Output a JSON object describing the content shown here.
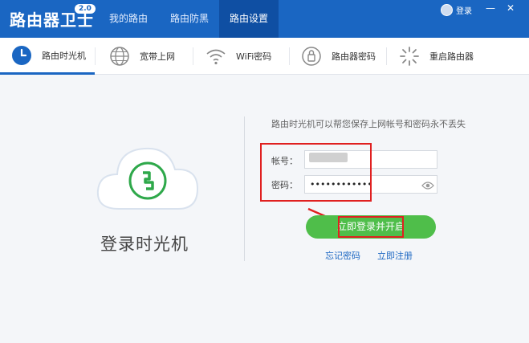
{
  "app": {
    "title": "路由器卫士",
    "version": "2.0"
  },
  "topnav": {
    "tabs": [
      {
        "label": "我的路由"
      },
      {
        "label": "路由防黑"
      },
      {
        "label": "路由设置"
      }
    ]
  },
  "login": {
    "label": "登录"
  },
  "window_controls": {
    "min": "—",
    "close": "✕"
  },
  "subnav": {
    "tabs": [
      {
        "label": "路由时光机",
        "icon": "clock-icon"
      },
      {
        "label": "宽带上网",
        "icon": "globe-icon"
      },
      {
        "label": "WiFi密码",
        "icon": "wifi-icon"
      },
      {
        "label": "路由器密码",
        "icon": "lock-icon"
      },
      {
        "label": "重启路由器",
        "icon": "restart-icon"
      }
    ]
  },
  "timemachine": {
    "title": "登录时光机",
    "hint": "路由时光机可以帮您保存上网帐号和密码永不丢失",
    "account_label": "帐号：",
    "password_label": "密码：",
    "password_value": "••••••••••••",
    "submit_label": "立即登录并开启",
    "forgot_label": "忘记密码",
    "register_label": "立即注册"
  },
  "colors": {
    "brand_blue": "#1a66c2",
    "active_tab": "#0f4fa3",
    "green": "#4fbe4a",
    "annotation_red": "#e02020"
  }
}
